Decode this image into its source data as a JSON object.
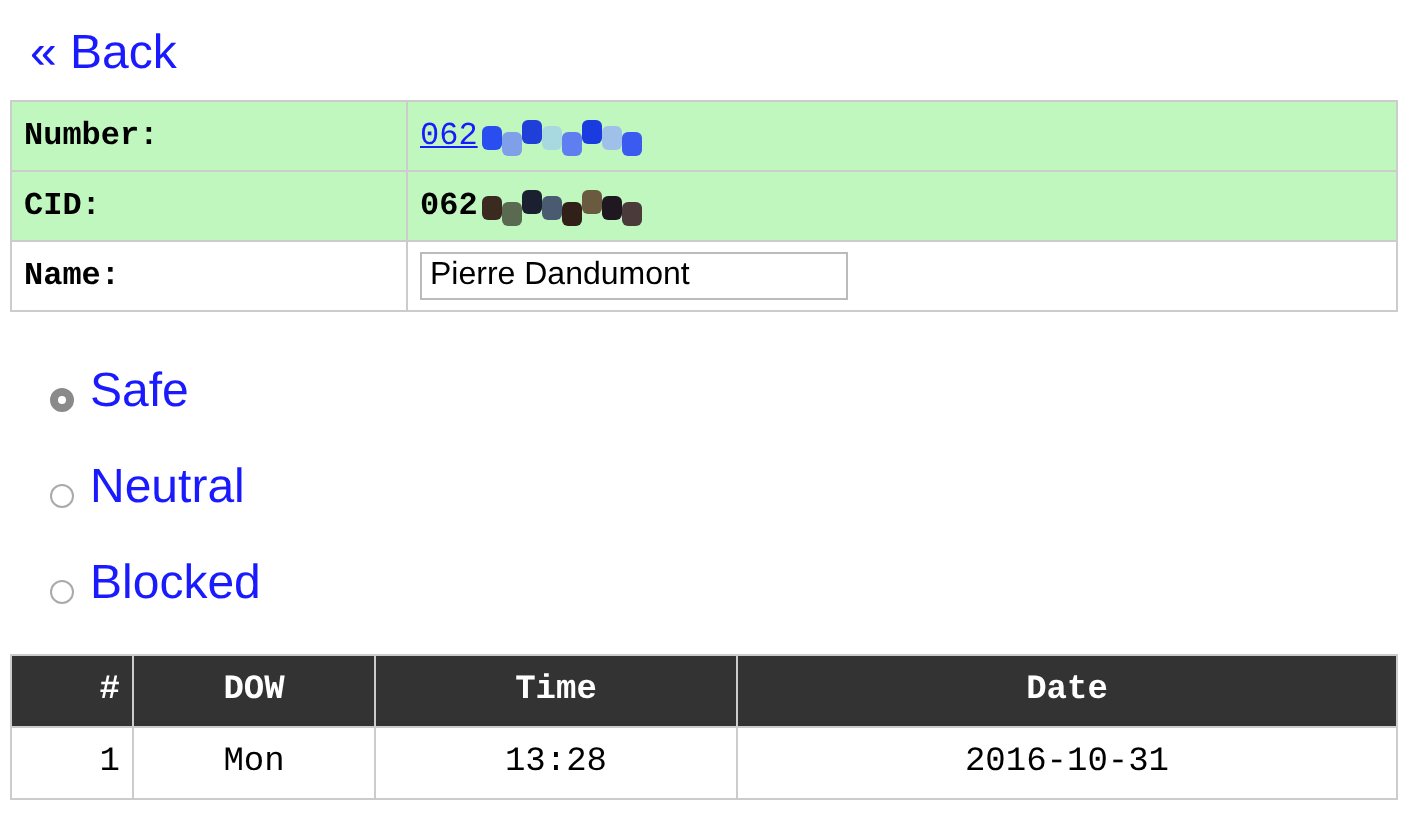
{
  "back_link": "« Back",
  "details": [
    {
      "kind": "link",
      "label": "Number:",
      "value": "062",
      "highlighted": true
    },
    {
      "kind": "text",
      "label": "CID:",
      "value": "062",
      "highlighted": true
    },
    {
      "kind": "input",
      "label": "Name:",
      "value": "Pierre Dandumont",
      "highlighted": false
    }
  ],
  "status_options": [
    {
      "label": "Safe",
      "selected": true
    },
    {
      "label": "Neutral",
      "selected": false
    },
    {
      "label": "Blocked",
      "selected": false
    }
  ],
  "calls_table": {
    "columns": [
      "#",
      "DOW",
      "Time",
      "Date"
    ],
    "rows": [
      [
        "1",
        "Mon",
        "13:28",
        "2016-10-31"
      ]
    ]
  }
}
